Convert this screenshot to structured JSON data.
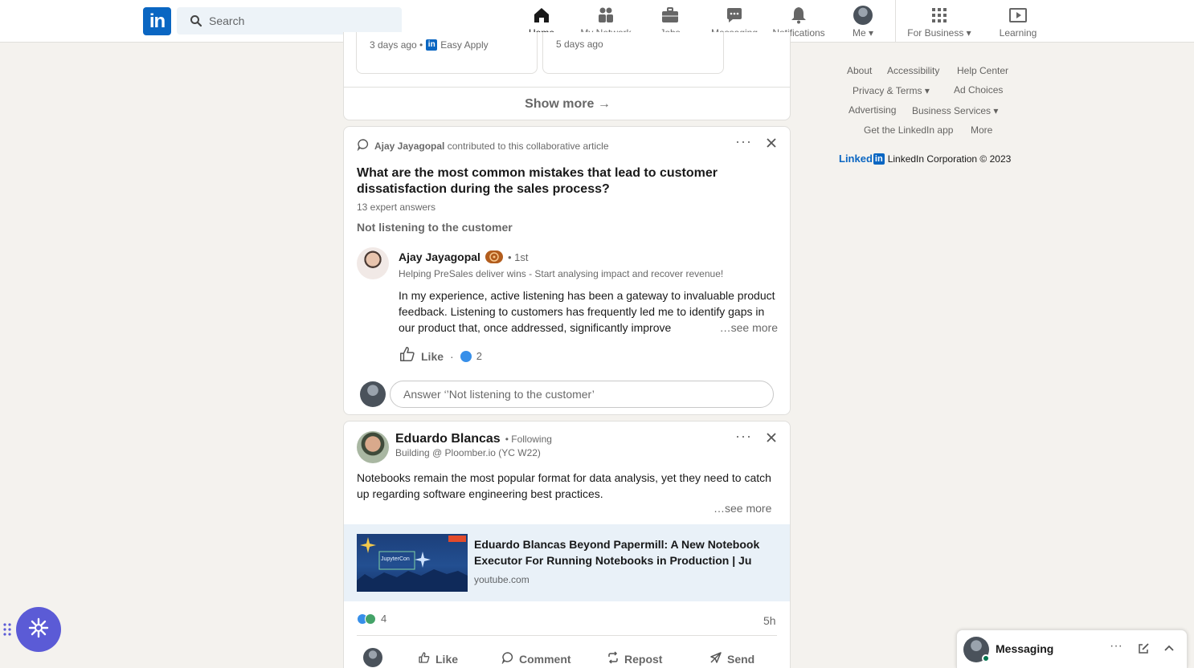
{
  "nav": {
    "logo_text": "in",
    "search_placeholder": "Search",
    "items": [
      {
        "label": "Home",
        "icon": "home-icon"
      },
      {
        "label": "My Network",
        "icon": "network-icon"
      },
      {
        "label": "Jobs",
        "icon": "briefcase-icon"
      },
      {
        "label": "Messaging",
        "icon": "messaging-icon"
      },
      {
        "label": "Notifications",
        "icon": "bell-icon"
      },
      {
        "label": "Me",
        "icon": "avatar"
      },
      {
        "label": "For Business",
        "icon": "grid-icon"
      },
      {
        "label": "Learning",
        "icon": "learning-icon"
      }
    ]
  },
  "jobs_card": {
    "job1_meta": "3 days ago •",
    "job1_apply": "Easy Apply",
    "job2_meta": "5 days ago",
    "show_more": "Show more →"
  },
  "article_card": {
    "contributor_name": "Ajay Jayagopal",
    "contributor_text": "contributed to this collaborative article",
    "question": "What are the most common mistakes that lead to customer dissatisfaction during the sales process?",
    "answers_count": "13 expert answers",
    "topic": "Not listening to the customer",
    "author_name": "Ajay Jayagopal",
    "author_degree": "• 1st",
    "author_headline": "Helping PreSales deliver wins - Start analysing impact and recover revenue!",
    "body": "In my experience, active listening has been a gateway to invaluable product feedback. Listening to customers has frequently led me to identify gaps in our product that, once addressed, significantly improve",
    "see_more": "…see more",
    "like_label": "Like",
    "dot_sep": "·",
    "like_count": "2",
    "answer_placeholder": "Answer ‘’Not listening to the customer’"
  },
  "post_card": {
    "author_name": "Eduardo Blancas",
    "follow_status": "• Following",
    "author_headline": "Building @ Ploomber.io (YC W22)",
    "body": "Notebooks remain the most popular format for data analysis, yet they need to catch up regarding software engineering best practices.",
    "see_more": "…see more",
    "link_title": "Eduardo Blancas Beyond Papermill: A New Notebook Executor For Running Notebooks in Production | Ju",
    "link_domain": "youtube.com",
    "thumbnail_text": "JupyterCon",
    "reactions_count": "4",
    "time_ago": "5h",
    "actions": [
      "Like",
      "Comment",
      "Repost",
      "Send"
    ]
  },
  "footer": {
    "links": [
      "About",
      "Accessibility",
      "Help Center",
      "Privacy & Terms",
      "Ad Choices",
      "Advertising",
      "Business Services",
      "Get the LinkedIn app",
      "More"
    ],
    "brand": "Linked",
    "brand_in": "in",
    "copyright": "LinkedIn Corporation © 2023"
  },
  "messaging": {
    "label": "Messaging"
  },
  "colors": {
    "brand_blue": "#0a66c2",
    "background": "#f4f2ee",
    "link_preview_bg": "#e9f1f8",
    "fab": "#5b5bd6"
  }
}
